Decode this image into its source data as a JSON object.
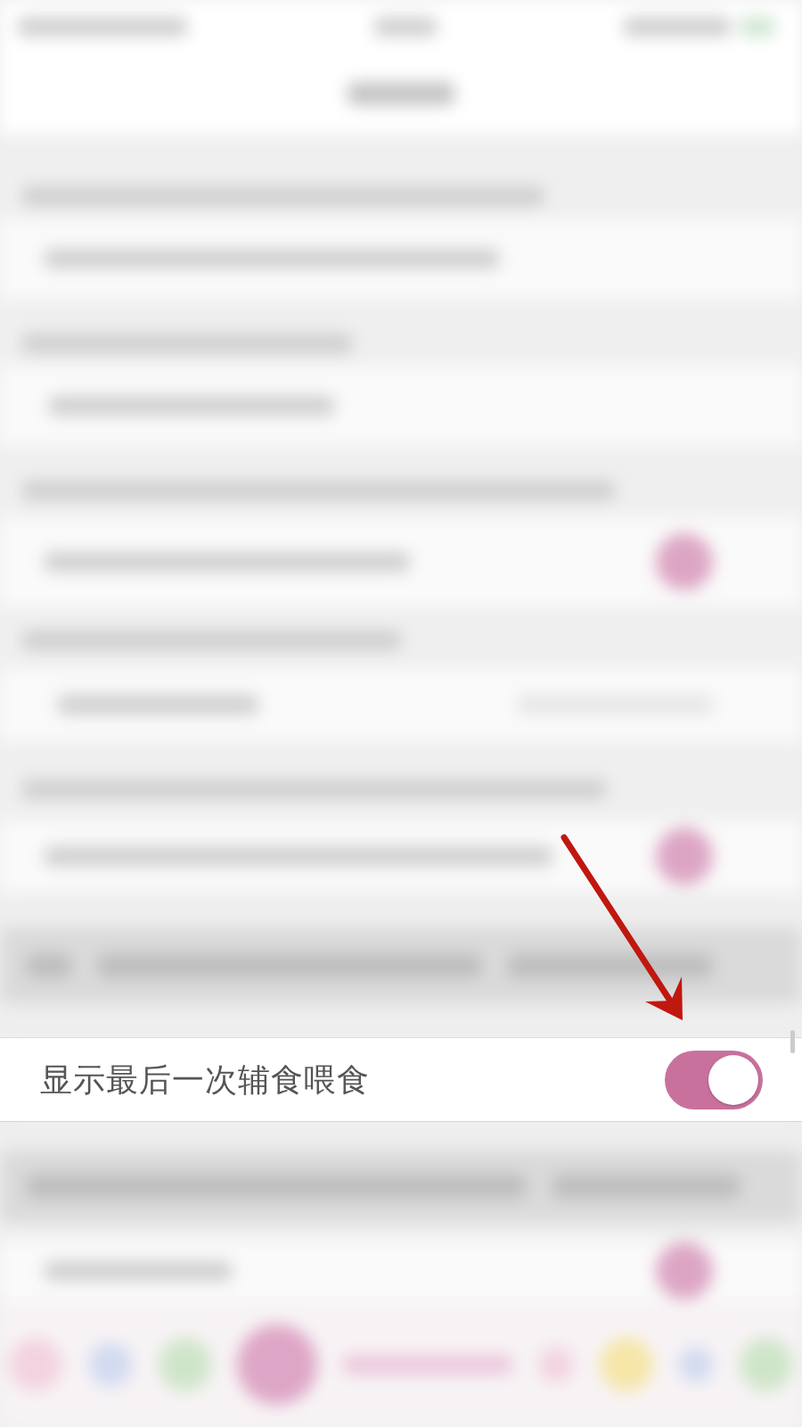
{
  "setting": {
    "label": "显示最后一次辅食喂食",
    "on": true
  }
}
